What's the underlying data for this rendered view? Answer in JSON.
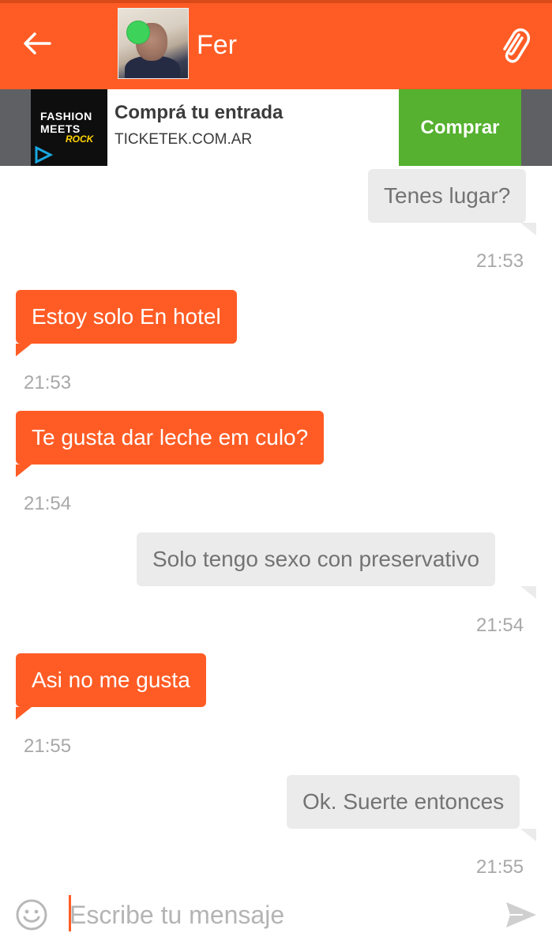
{
  "header": {
    "back_icon": "arrow-left-icon",
    "contact_name": "Fer",
    "online": true,
    "attach_icon": "paperclip-icon",
    "color": "#ff5c25"
  },
  "ad": {
    "logo_line1": "FASHION",
    "logo_line2": "MEETS",
    "logo_line3": "ROCK",
    "title": "Comprá tu entrada",
    "subtitle": "TICKETEK.COM.AR",
    "cta": "Comprar",
    "cta_color": "#55b12f"
  },
  "messages": [
    {
      "direction": "out",
      "text": "Tenes lugar?",
      "time": "21:53"
    },
    {
      "direction": "in",
      "text": "Estoy solo En hotel",
      "time": "21:53"
    },
    {
      "direction": "in",
      "text": "Te gusta dar leche em culo?",
      "time": "21:54"
    },
    {
      "direction": "out",
      "text": "Solo tengo sexo con preservativo",
      "time": "21:54"
    },
    {
      "direction": "in",
      "text": "Asi no me gusta",
      "time": "21:55"
    },
    {
      "direction": "out",
      "text": "Ok. Suerte entonces",
      "time": "21:55"
    }
  ],
  "composer": {
    "placeholder": "Escribe tu mensaje",
    "emoji_icon": "emoji-icon",
    "send_icon": "send-icon"
  }
}
